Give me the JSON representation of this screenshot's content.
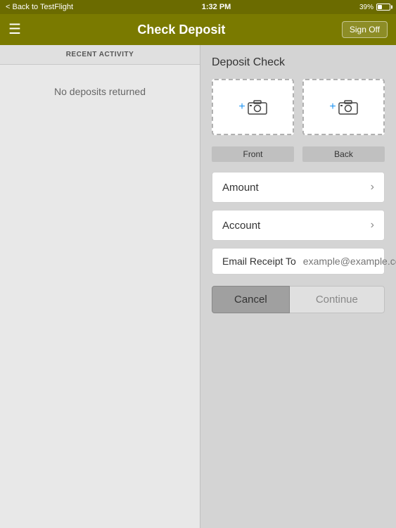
{
  "statusBar": {
    "backLabel": "< Back to TestFlight",
    "time": "1:32 PM",
    "batteryPercent": "39%"
  },
  "navBar": {
    "menuIcon": "☰",
    "title": "Check Deposit",
    "signOffLabel": "Sign Off"
  },
  "leftPanel": {
    "recentActivityLabel": "RECENT ACTIVITY",
    "noDepositsLabel": "No deposits returned"
  },
  "rightPanel": {
    "depositCheckTitle": "Deposit Check",
    "frontLabel": "Front",
    "backLabel": "Back",
    "amountLabel": "Amount",
    "accountLabel": "Account",
    "emailReceiptLabel": "Email Receipt To",
    "emailPlaceholder": "example@example.com",
    "cancelLabel": "Cancel",
    "continueLabel": "Continue"
  }
}
